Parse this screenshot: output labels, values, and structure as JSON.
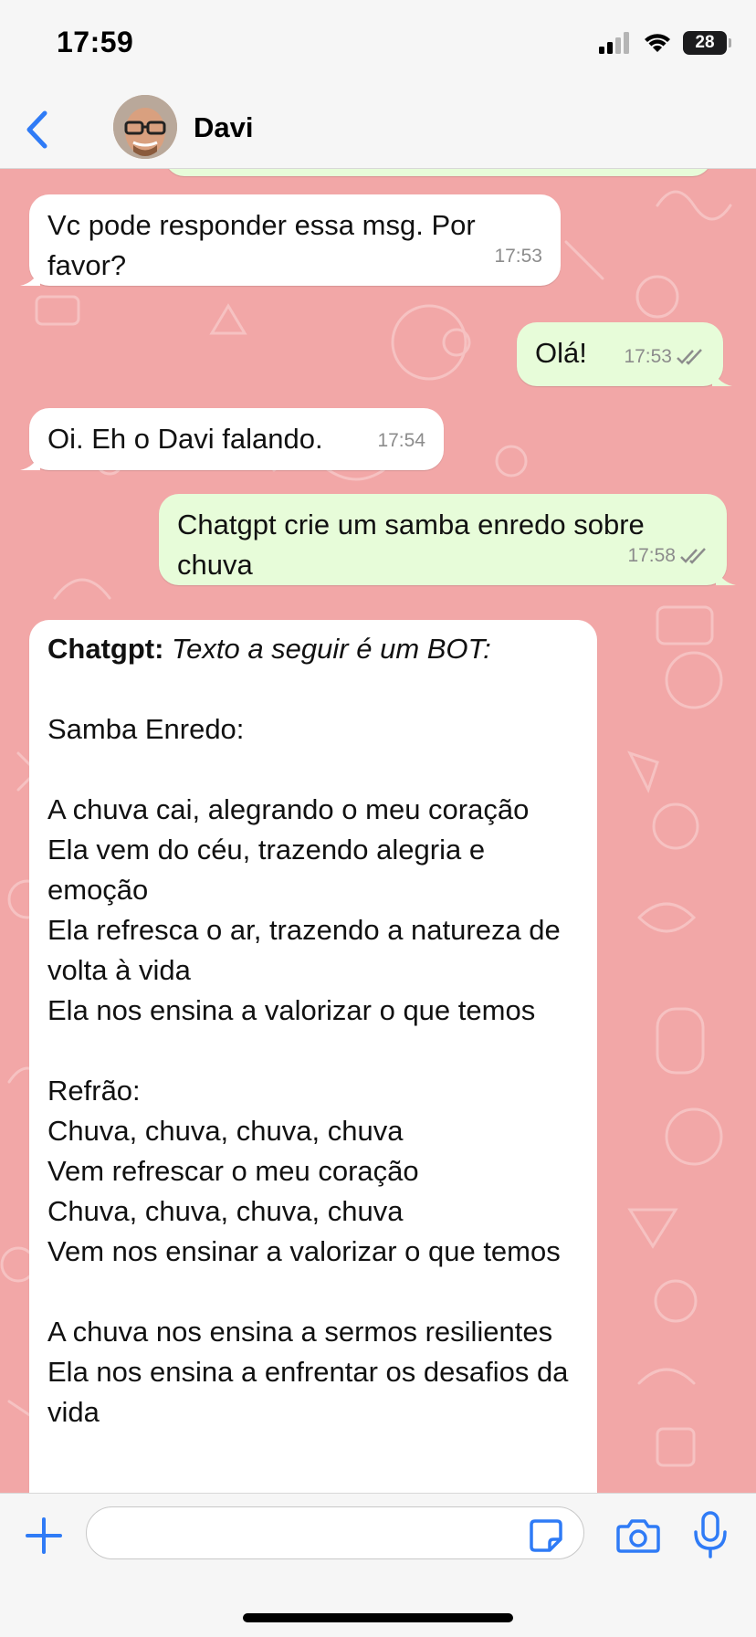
{
  "status_bar": {
    "time": "17:59",
    "battery": "28"
  },
  "header": {
    "contact_name": "Davi"
  },
  "messages": [
    {
      "text": "Vc pode responder essa msg. Por favor?",
      "time": "17:53"
    },
    {
      "text": "Olá!",
      "time": "17:53"
    },
    {
      "text": "Oi. Eh o Davi falando.",
      "time": "17:54"
    },
    {
      "text": "Chatgpt crie um samba enredo sobre chuva",
      "time": "17:58"
    },
    {
      "bold": "Chatgpt:",
      "italic": "Texto a seguir é um BOT:",
      "body": "Samba Enredo:\n\nA chuva cai, alegrando o meu coração\nEla vem do céu, trazendo alegria e emoção\nEla refresca o ar, trazendo a natureza de volta à vida\nEla nos ensina a valorizar o que temos\n\nRefrão:\nChuva, chuva, chuva, chuva\nVem refrescar o meu coração\nChuva, chuva, chuva, chuva\nVem nos ensinar a valorizar o que temos\n\nA chuva nos ensina a sermos resilientes\nEla nos ensina a enfrentar os desafios da vida"
    }
  ],
  "colors": {
    "chat_background": "#f2a7a7",
    "outgoing_bubble": "#e7fcd9",
    "incoming_bubble": "#ffffff",
    "accent": "#2f7bf6"
  },
  "icons": {
    "back": "chevron-left-icon",
    "read_receipt": "double-check-icon",
    "plus": "plus-icon",
    "sticker": "sticker-icon",
    "camera": "camera-icon",
    "mic": "microphone-icon"
  }
}
